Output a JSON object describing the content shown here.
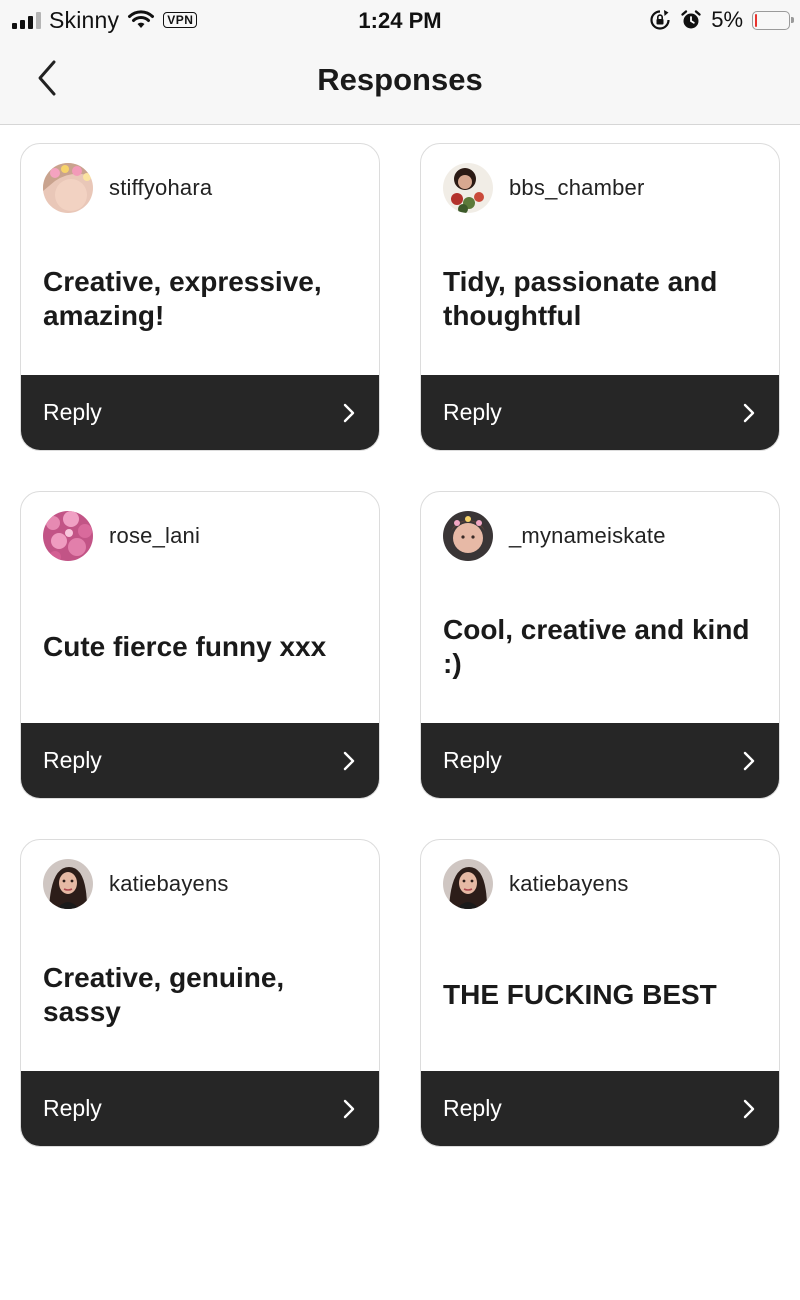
{
  "status_bar": {
    "carrier": "Skinny",
    "vpn_label": "VPN",
    "time": "1:24 PM",
    "battery_percent": "5%",
    "battery_level": 0.05,
    "battery_color": "#e8322d"
  },
  "header": {
    "title": "Responses",
    "back_icon": "chevron-left-icon"
  },
  "responses": [
    {
      "username": "stiffyohara",
      "text": "Creative, expressive, amazing!",
      "reply_label": "Reply"
    },
    {
      "username": "bbs_chamber",
      "text": "Tidy, passionate and thoughtful",
      "reply_label": "Reply"
    },
    {
      "username": "rose_lani",
      "text": "Cute fierce funny xxx",
      "reply_label": "Reply"
    },
    {
      "username": "_mynameiskate",
      "text": "Cool, creative and kind :)",
      "reply_label": "Reply"
    },
    {
      "username": "katiebayens",
      "text": "Creative, genuine, sassy",
      "reply_label": "Reply"
    },
    {
      "username": "katiebayens",
      "text": "THE FUCKING BEST",
      "reply_label": "Reply"
    }
  ],
  "colors": {
    "reply_bar": "#262626",
    "card_border": "#dcdcdc",
    "header_bg": "#f7f7f7"
  }
}
